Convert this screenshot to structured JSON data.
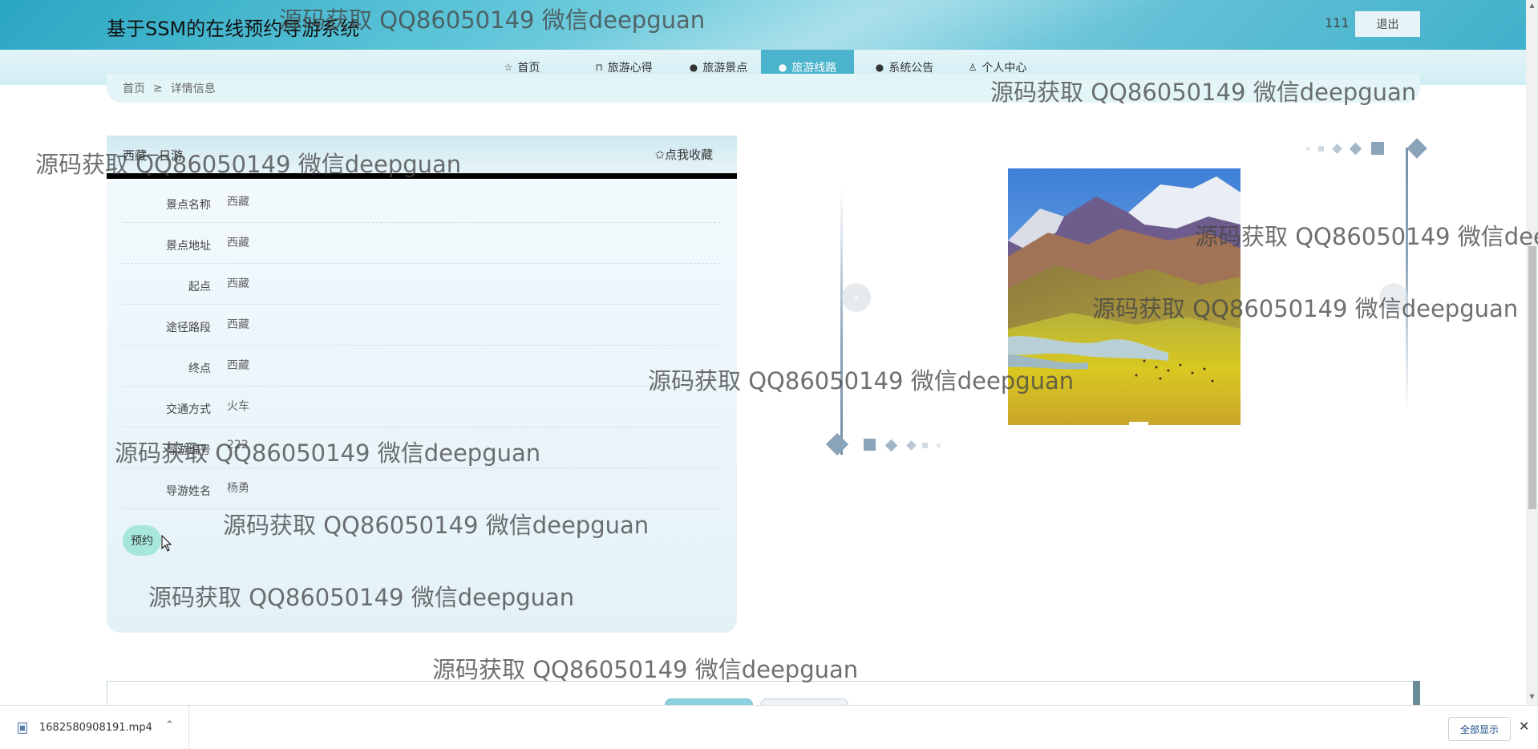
{
  "header": {
    "site_title": "基于SSM的在线预约导游系统",
    "username": "111",
    "logout_label": "退出"
  },
  "nav": {
    "items": [
      {
        "label": "首页",
        "icon": "star-icon"
      },
      {
        "label": "旅游心得",
        "icon": "bag-icon"
      },
      {
        "label": "旅游景点",
        "icon": "info-icon"
      },
      {
        "label": "旅游线路",
        "icon": "help-icon",
        "active": true
      },
      {
        "label": "系统公告",
        "icon": "info-icon"
      },
      {
        "label": "个人中心",
        "icon": "user-icon"
      }
    ]
  },
  "breadcrumb": {
    "home": "首页",
    "separator": "≥",
    "current": "详情信息"
  },
  "detail": {
    "title": "西藏一日游",
    "favorite_label": "✩点我收藏",
    "fields": [
      {
        "label": "景点名称",
        "value": "西藏"
      },
      {
        "label": "景点地址",
        "value": "西藏"
      },
      {
        "label": "起点",
        "value": "西藏"
      },
      {
        "label": "途径路段",
        "value": "西藏"
      },
      {
        "label": "终点",
        "value": "西藏"
      },
      {
        "label": "交通方式",
        "value": "火车"
      },
      {
        "label": "导游编号",
        "value": "222"
      },
      {
        "label": "导游姓名",
        "value": "杨勇"
      }
    ],
    "book_label": "预约"
  },
  "carousel": {
    "prev_label": "‹",
    "active_index": 0
  },
  "download_bar": {
    "file_name": "1682580908191.mp4",
    "show_all_label": "全部显示",
    "close_label": "✕"
  },
  "watermark_text": "源码获取 QQ86050149 微信deepguan",
  "colors": {
    "header": "#3fb1cb",
    "nav_active": "#4cb3cc",
    "book_button": "#a6e6dc",
    "card_bg": "#eaf5fa"
  }
}
